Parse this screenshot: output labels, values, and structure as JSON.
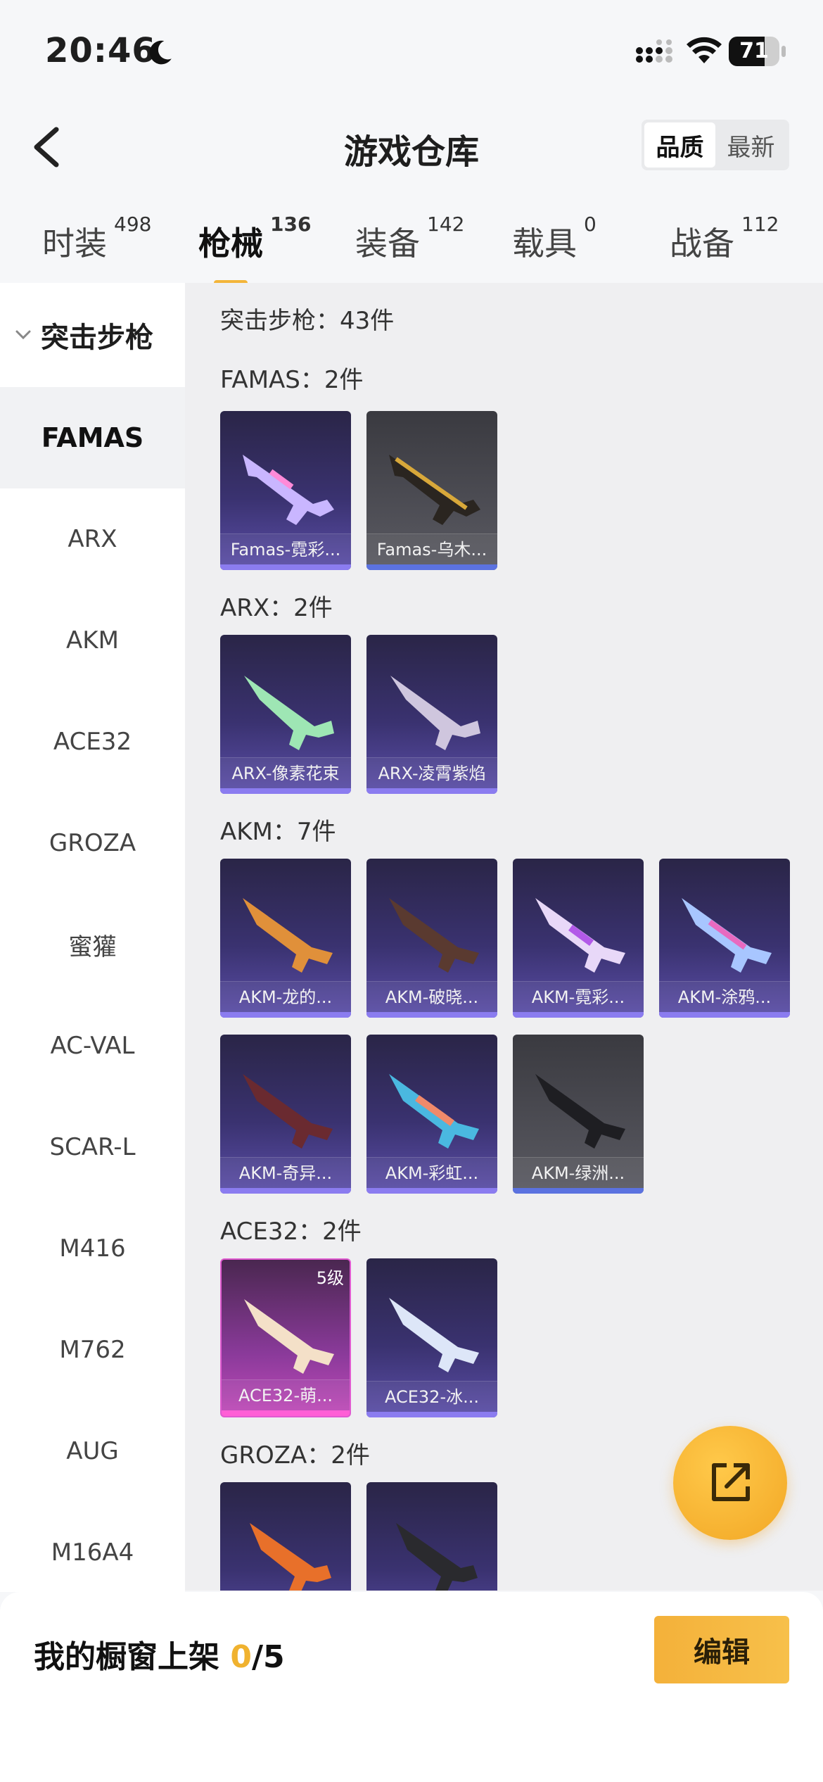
{
  "status_bar": {
    "time": "20:46",
    "battery": "71"
  },
  "header": {
    "title": "游戏仓库",
    "sort_options": [
      "品质",
      "最新"
    ]
  },
  "tabs": [
    {
      "label": "时装",
      "count": "498"
    },
    {
      "label": "枪械",
      "count": "136"
    },
    {
      "label": "装备",
      "count": "142"
    },
    {
      "label": "载具",
      "count": "0"
    },
    {
      "label": "战备",
      "count": "112"
    }
  ],
  "sidebar": {
    "group": "突击步枪",
    "items": [
      "FAMAS",
      "ARX",
      "AKM",
      "ACE32",
      "GROZA",
      "蜜獾",
      "AC-VAL",
      "SCAR-L",
      "M416",
      "M762",
      "AUG",
      "M16A4"
    ]
  },
  "content": {
    "total": "突击步枪：43件",
    "sections": [
      {
        "title": "FAMAS：2件",
        "items": [
          {
            "name": "Famas-霓彩...",
            "color": "#8b7cf0"
          },
          {
            "name": "Famas-乌木...",
            "color": "#5b72e0"
          }
        ]
      },
      {
        "title": "ARX：2件",
        "items": [
          {
            "name": "ARX-像素花束",
            "color": "#8b7cf0"
          },
          {
            "name": "ARX-凌霄紫焰",
            "color": "#8b7cf0"
          }
        ]
      },
      {
        "title": "AKM：7件",
        "items": [
          {
            "name": "AKM-龙的..."
          },
          {
            "name": "AKM-破晓..."
          },
          {
            "name": "AKM-霓彩..."
          },
          {
            "name": "AKM-涂鸦..."
          },
          {
            "name": "AKM-奇异..."
          },
          {
            "name": "AKM-彩虹..."
          },
          {
            "name": "AKM-绿洲..."
          }
        ]
      },
      {
        "title": "ACE32：2件",
        "items": [
          {
            "name": "ACE32-萌...",
            "level": "5级"
          },
          {
            "name": "ACE32-冰..."
          }
        ]
      },
      {
        "title": "GROZA：2件",
        "items": []
      }
    ]
  },
  "bottom_bar": {
    "label_prefix": "我的橱窗上架 ",
    "count": "0",
    "max": "/5",
    "edit_label": "编辑"
  },
  "colors": {
    "accent": "#f3b53a",
    "card_purple": "#3a3270",
    "card_pink": "#c04ab8"
  }
}
